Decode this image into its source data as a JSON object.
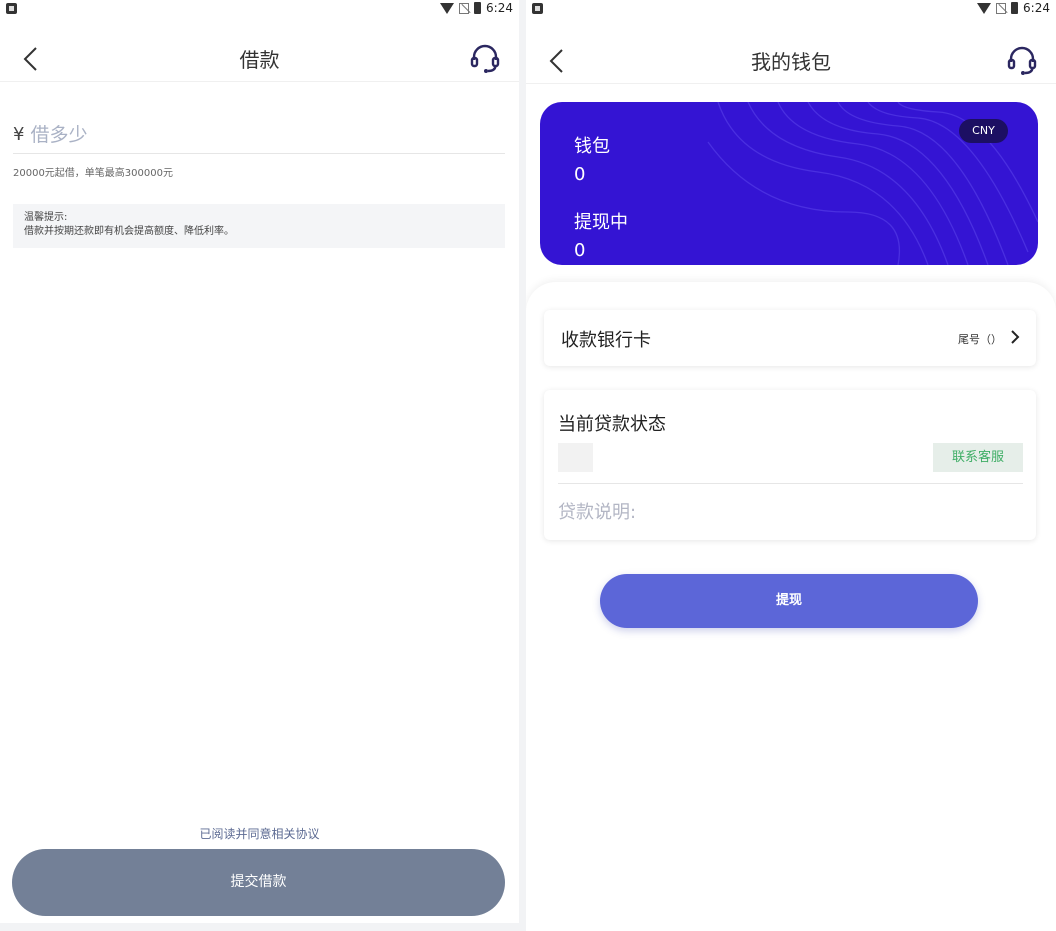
{
  "status_bar": {
    "time": "6:24"
  },
  "borrow_screen": {
    "title": "借款",
    "currency_symbol": "¥",
    "amount_placeholder": "借多少",
    "amount_value": "",
    "range_hint": "20000元起借，单笔最高300000元",
    "tip_title": "温馨提示:",
    "tip_body": "借款并按期还款即有机会提高额度、降低利率。",
    "agreement_text": "已阅读并同意相关协议",
    "submit_label": "提交借款"
  },
  "wallet_screen": {
    "title": "我的钱包",
    "currency_badge": "CNY",
    "wallet_label": "钱包",
    "wallet_value": "0",
    "withdrawing_label": "提现中",
    "withdrawing_value": "0",
    "bank_card_label": "收款银行卡",
    "bank_card_tail": "尾号（）",
    "loan_status_title": "当前贷款状态",
    "contact_service_label": "联系客服",
    "loan_description_label": "贷款说明:",
    "withdraw_label": "提现"
  },
  "colors": {
    "card_bg": "#3414d3",
    "badge_bg": "#1c0f63",
    "submit_bg": "#738097",
    "withdraw_bg": "#5c66d8",
    "contact_text": "#3fae66"
  },
  "icons": [
    "back-icon",
    "headset-icon",
    "chevron-right-icon",
    "wifi-icon",
    "battery-icon"
  ]
}
